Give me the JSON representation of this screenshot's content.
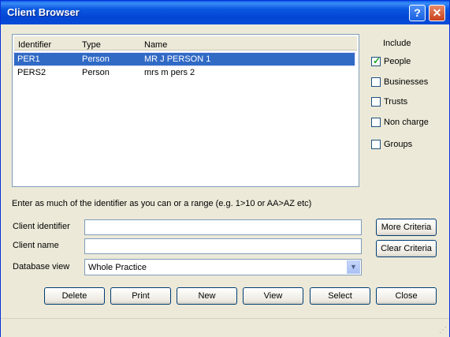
{
  "window": {
    "title": "Client Browser"
  },
  "titlebar": {
    "help": "?",
    "close": "✕"
  },
  "list": {
    "headers": [
      "Identifier",
      "Type",
      "Name"
    ],
    "rows": [
      {
        "identifier": "PER1",
        "type": "Person",
        "name": "MR J PERSON 1",
        "selected": true
      },
      {
        "identifier": "PERS2",
        "type": "Person",
        "name": "mrs m pers 2",
        "selected": false
      }
    ]
  },
  "include": {
    "title": "Include",
    "options": [
      {
        "label": "People",
        "checked": true
      },
      {
        "label": "Businesses",
        "checked": false
      },
      {
        "label": "Trusts",
        "checked": false
      },
      {
        "label": "Non charge",
        "checked": false
      },
      {
        "label": "Groups",
        "checked": false
      }
    ]
  },
  "hint": "Enter as much of the identifier as you can or a range (e.g. 1>10 or AA>AZ etc)",
  "form": {
    "client_identifier_label": "Client identifier",
    "client_identifier_value": "",
    "client_name_label": "Client name",
    "client_name_value": "",
    "database_view_label": "Database view",
    "database_view_value": "Whole Practice"
  },
  "side_buttons": {
    "more_criteria": "More Criteria",
    "clear_criteria": "Clear Criteria"
  },
  "bottom_buttons": [
    "Delete",
    "Print",
    "New",
    "View",
    "Select",
    "Close"
  ]
}
